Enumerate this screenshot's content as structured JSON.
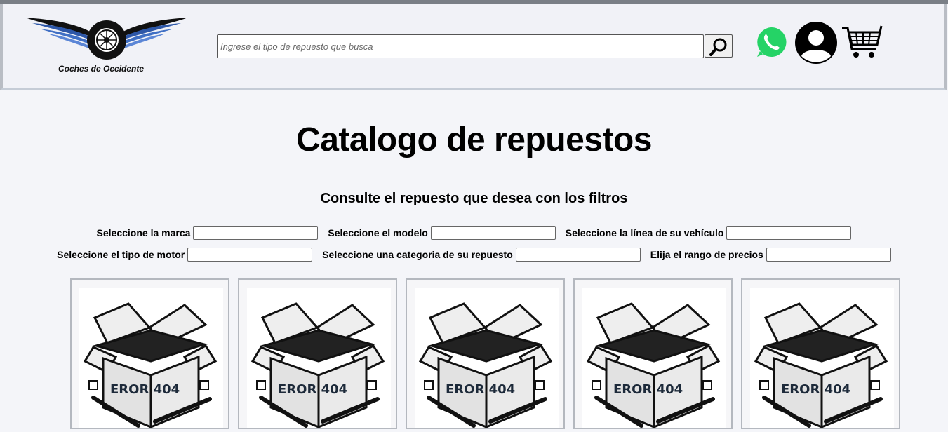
{
  "header": {
    "brand_name": "Coches de Occidente",
    "search_placeholder": "Ingrese el tipo de repuesto que busca",
    "icons": [
      "search-icon",
      "whatsapp-icon",
      "user-icon",
      "cart-icon"
    ],
    "colors": {
      "logo_wings": "#2d57a8",
      "whatsapp": "#25d366"
    }
  },
  "main": {
    "title": "Catalogo de repuestos",
    "subtitle": "Consulte el repuesto que desea con los filtros",
    "filters": [
      {
        "label": "Seleccione la marca",
        "value": ""
      },
      {
        "label": "Seleccione el modelo",
        "value": ""
      },
      {
        "label": "Seleccione la línea de su vehículo",
        "value": ""
      },
      {
        "label": "Seleccione el tipo de motor",
        "value": ""
      },
      {
        "label": "Seleccione una categoria de su repuesto",
        "value": ""
      },
      {
        "label": "Elija el rango de precios",
        "value": ""
      }
    ]
  },
  "products": [
    {
      "image_text": "EROR 404"
    },
    {
      "image_text": "EROR 404"
    },
    {
      "image_text": "EROR 404"
    },
    {
      "image_text": "EROR 404"
    },
    {
      "image_text": "EROR 404"
    }
  ]
}
